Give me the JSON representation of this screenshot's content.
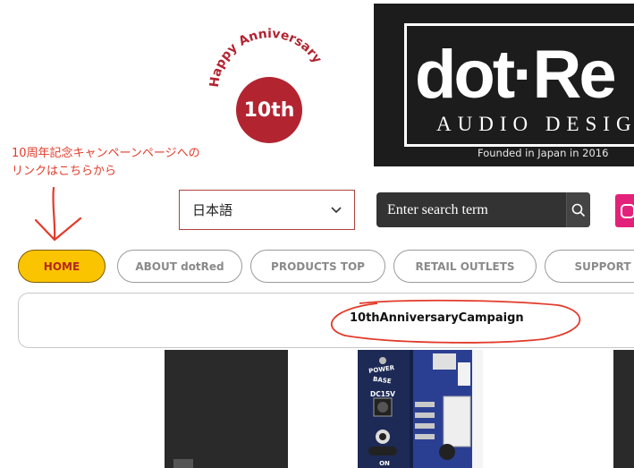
{
  "badge": {
    "arc_text": "Happy Anniversary",
    "number": "10th"
  },
  "logo": {
    "wordmark": "dot·Re",
    "subtitle": "AUDIO DESIG",
    "founded": "Founded in Japan in 2016",
    "accent_color": "#c11f2b"
  },
  "annotation": {
    "line1": "10周年記念キャンペーンページへの",
    "line2": "リンクはこちらから",
    "color": "#e23b2a"
  },
  "language_select": {
    "value": "日本語",
    "icon": "chevron-down-icon"
  },
  "search": {
    "placeholder": "Enter search term",
    "icon": "search-icon"
  },
  "social": {
    "icon": "instagram-icon",
    "color": "#e4217a"
  },
  "nav": {
    "items": [
      {
        "label": "HOME",
        "active": true
      },
      {
        "label": "ABOUT dotRed",
        "active": false
      },
      {
        "label": "PRODUCTS TOP",
        "active": false
      },
      {
        "label": "RETAIL OUTLETS",
        "active": false
      },
      {
        "label": "SUPPORT",
        "active": false
      }
    ],
    "active_color": "#fbc400"
  },
  "campaign": {
    "label": "10thAnniversaryCampaign"
  },
  "product_image": {
    "labels": [
      "POWER",
      "BASE",
      "DC15V",
      "ON"
    ]
  }
}
